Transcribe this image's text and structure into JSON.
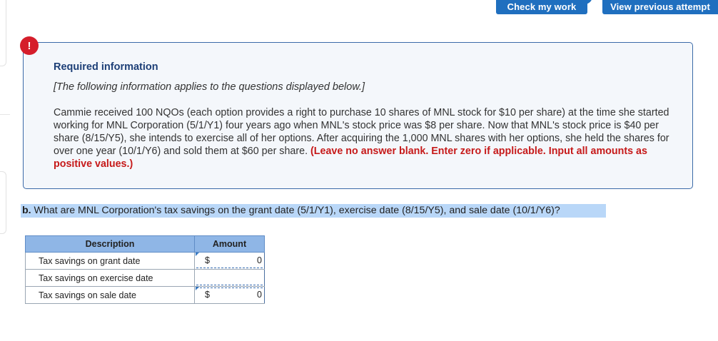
{
  "toolbar": {
    "check_label": "Check my work",
    "view_label": "View previous attempt"
  },
  "alert": {
    "icon": "!"
  },
  "info": {
    "title": "Required information",
    "note": "[The following information applies to the questions displayed below.]",
    "paragraph": "Cammie received 100 NQOs (each option provides a right to purchase 10 shares of MNL stock for $10 per share) at the time she started working for MNL Corporation (5/1/Y1) four years ago when MNL's stock price was $8 per share. Now that MNL's stock price is $40 per share (8/15/Y5), she intends to exercise all of her options. After acquiring the 1,000 MNL shares with her options, she held the shares for over one year (10/1/Y6) and sold them at $60 per share. ",
    "instruction": "(Leave no answer blank. Enter zero if applicable. Input all amounts as positive values.)"
  },
  "question": {
    "label": "b.",
    "text": " What are MNL Corporation's tax savings on the grant date (5/1/Y1), exercise date (8/15/Y5), and sale date (10/1/Y6)?"
  },
  "table": {
    "headers": [
      "Description",
      "Amount"
    ],
    "rows": [
      {
        "description": "Tax savings on grant date",
        "currency": "$",
        "amount": "0"
      },
      {
        "description": "Tax savings on exercise date",
        "currency": "",
        "amount": ""
      },
      {
        "description": "Tax savings on sale date",
        "currency": "$",
        "amount": "0"
      }
    ]
  }
}
